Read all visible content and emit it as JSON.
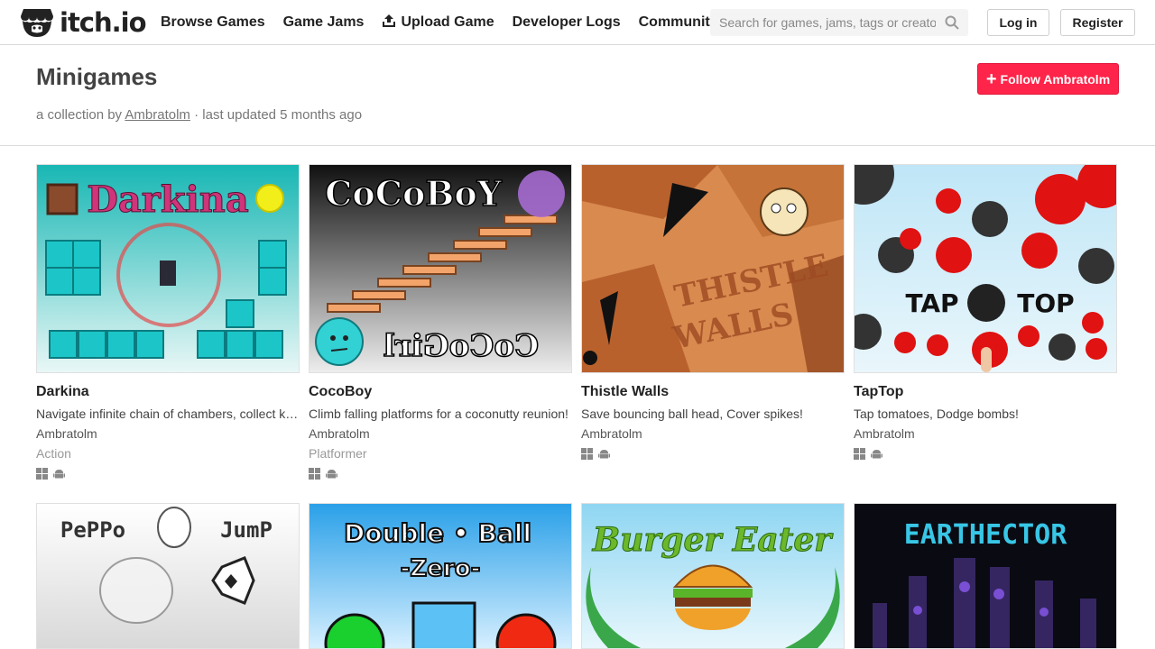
{
  "site": {
    "name": "itch.io"
  },
  "nav": {
    "items": [
      "Browse Games",
      "Game Jams",
      "Upload Game",
      "Developer Logs",
      "Community"
    ]
  },
  "search": {
    "placeholder": "Search for games, jams, tags or creators"
  },
  "auth": {
    "login": "Log in",
    "register": "Register"
  },
  "collection": {
    "title": "Minigames",
    "prefix": "a collection by",
    "author": "Ambratolm",
    "updated": "· last updated 5 months ago",
    "follow_label": "Follow Ambratolm"
  },
  "games": [
    {
      "title": "Darkina",
      "description": "Navigate infinite chain of chambers, collect keys, dodge enemies!",
      "author": "Ambratolm",
      "genre": "Action",
      "platforms": [
        "windows-icon",
        "android-icon"
      ],
      "cover_text": "Darkina"
    },
    {
      "title": "CocoBoy",
      "description": "Climb falling platforms for a coconutty reunion!",
      "author": "Ambratolm",
      "genre": "Platformer",
      "platforms": [
        "windows-icon",
        "android-icon"
      ],
      "cover_text": "CoCoBoY",
      "cover_text2": "CoCoGirl"
    },
    {
      "title": "Thistle Walls",
      "description": "Save bouncing ball head, Cover spikes!",
      "author": "Ambratolm",
      "genre": "",
      "platforms": [
        "windows-icon",
        "android-icon"
      ],
      "cover_text": "THISTLE",
      "cover_text2": "WALLS"
    },
    {
      "title": "TapTop",
      "description": "Tap tomatoes, Dodge bombs!",
      "author": "Ambratolm",
      "genre": "",
      "platforms": [
        "windows-icon",
        "android-icon"
      ],
      "cover_text": "TAP",
      "cover_text2": "TOP"
    },
    {
      "title": "",
      "cover_text": "PePPo",
      "cover_text2": "JumP"
    },
    {
      "title": "",
      "cover_text": "Double • Ball",
      "cover_text2": "-Zero-"
    },
    {
      "title": "",
      "cover_text": "Burger Eater"
    },
    {
      "title": "",
      "cover_text": "EARTHECTOR"
    }
  ],
  "colors": {
    "accent": "#ff2449",
    "link": "#777777"
  }
}
